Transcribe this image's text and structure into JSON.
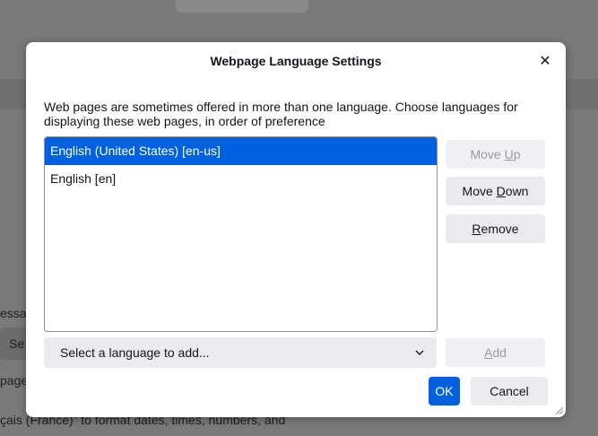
{
  "dialog": {
    "title": "Webpage Language Settings",
    "close_glyph": "✕",
    "description": "Web pages are sometimes offered in more than one language. Choose languages for displaying these web pages, in order of preference",
    "languages": [
      {
        "label": "English (United States) [en-us]",
        "selected": true
      },
      {
        "label": "English [en]",
        "selected": false
      }
    ],
    "move_up": {
      "pre": "Move ",
      "key": "U",
      "post": "p",
      "enabled": false
    },
    "move_down": {
      "pre": "Move ",
      "key": "D",
      "post": "own",
      "enabled": true
    },
    "remove": {
      "pre": "",
      "key": "R",
      "post": "emove",
      "enabled": true
    },
    "select_placeholder": "Select a language to add...",
    "chevron_glyph": "⌄",
    "add": {
      "pre": "",
      "key": "A",
      "post": "dd",
      "enabled": false
    },
    "ok_label": "OK",
    "cancel_label": "Cancel"
  },
  "background": {
    "fragment1": "essa",
    "button_fragment": "Se",
    "fragment2": "page",
    "fragment3": "çais (France)” to format dates, times, numbers, and"
  },
  "colors": {
    "accent": "#0061e0",
    "overlay": "#7a7a7b"
  }
}
